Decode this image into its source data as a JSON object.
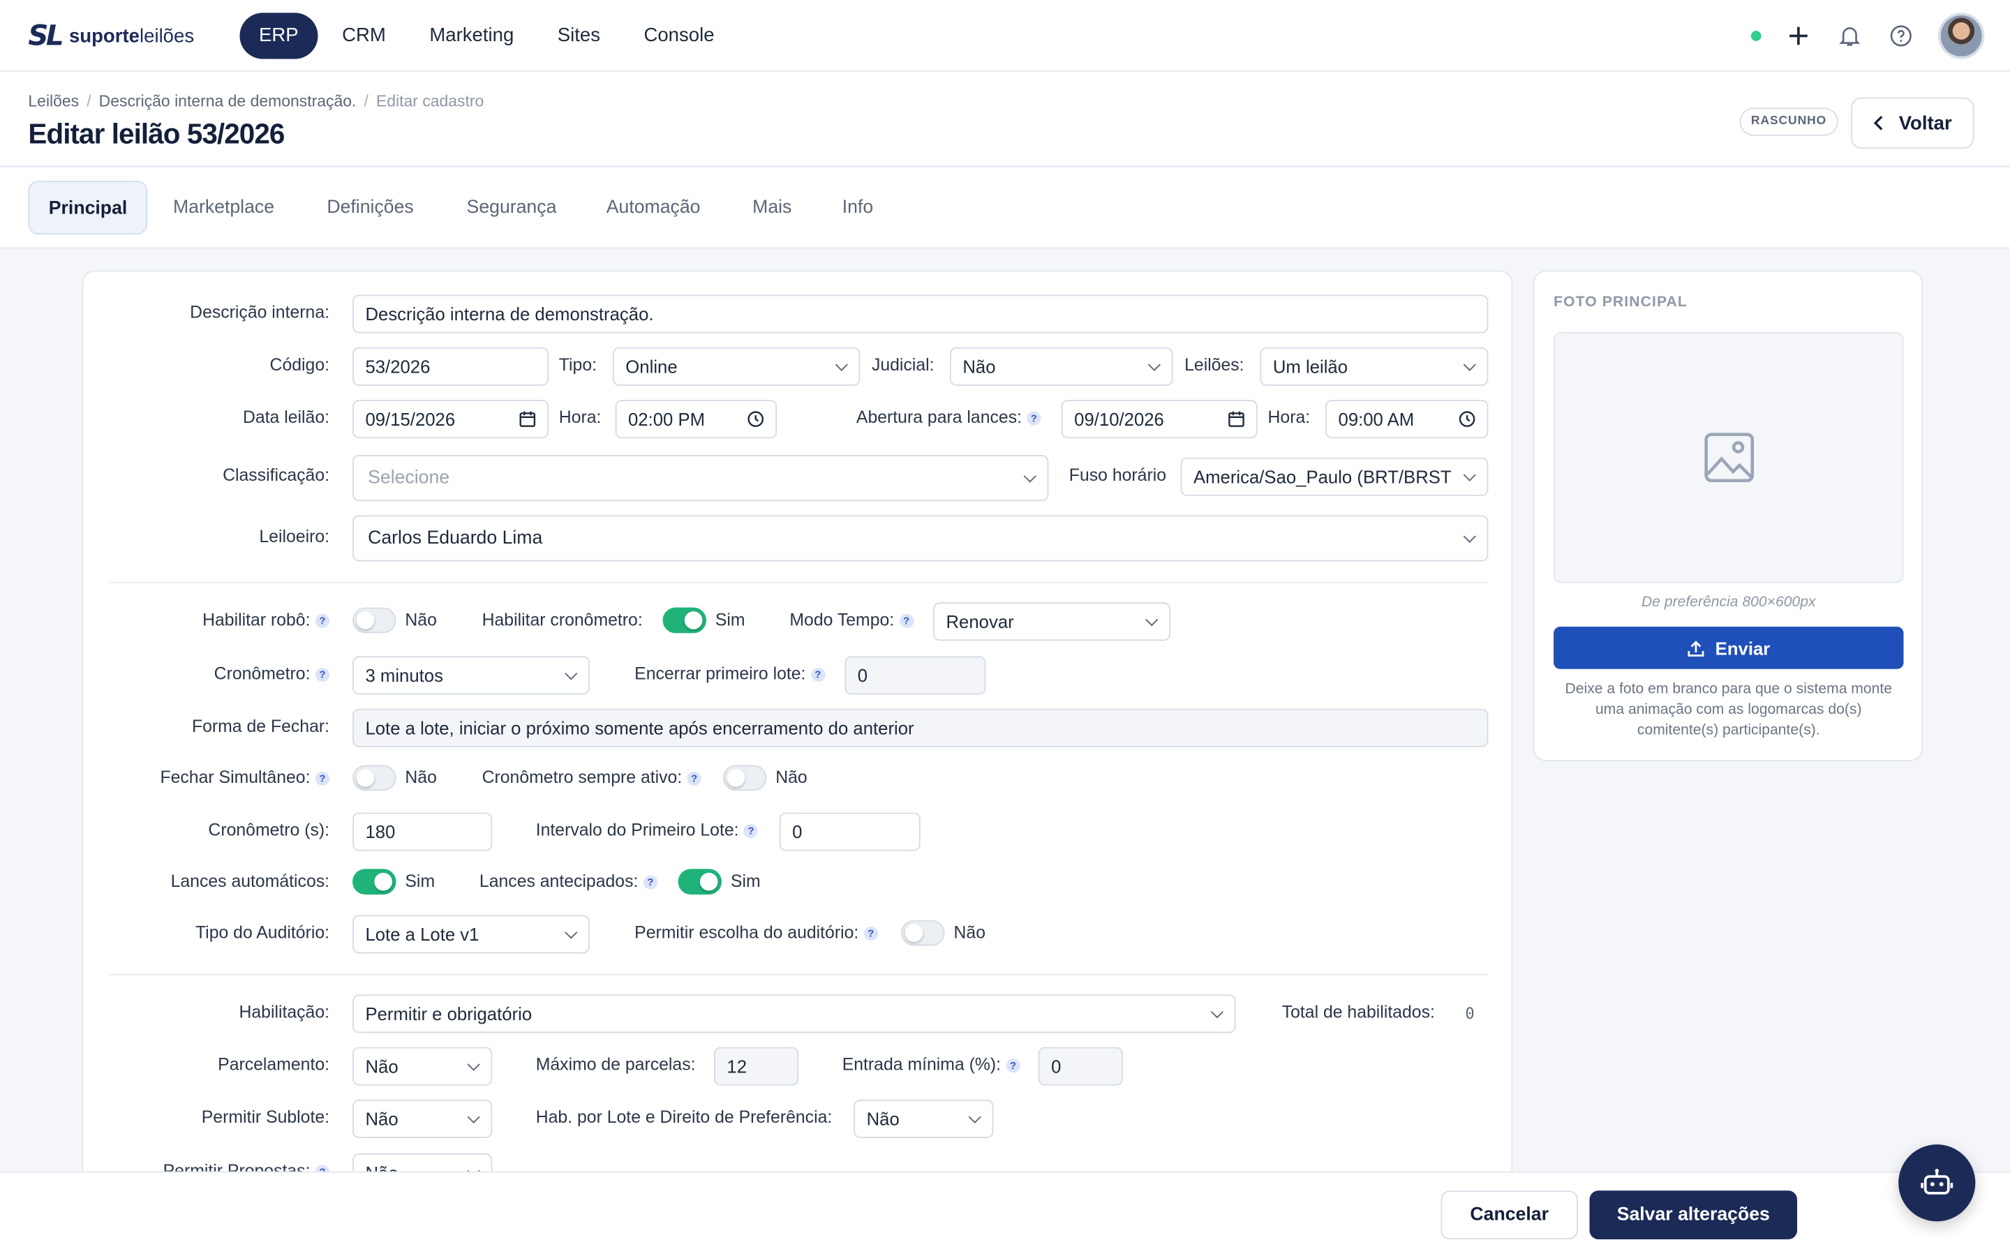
{
  "brand": {
    "mark": "SL",
    "name_bold": "suporte",
    "name_rest": "leilões"
  },
  "nav": [
    {
      "label": "ERP"
    },
    {
      "label": "CRM"
    },
    {
      "label": "Marketing"
    },
    {
      "label": "Sites"
    },
    {
      "label": "Console"
    }
  ],
  "topbar": {
    "status_color": "#2fcf8e",
    "icons": [
      "plus-icon",
      "bell-icon",
      "help-icon"
    ]
  },
  "breadcrumb": [
    "Leilões",
    "Descrição interna de demonstração.",
    "Editar cadastro"
  ],
  "page": {
    "title": "Editar leilão 53/2026",
    "status": "RASCUNHO",
    "back_label": "Voltar"
  },
  "tabs": [
    {
      "label": "Principal"
    },
    {
      "label": "Marketplace"
    },
    {
      "label": "Definições"
    },
    {
      "label": "Segurança"
    },
    {
      "label": "Automação"
    },
    {
      "label": "Mais"
    },
    {
      "label": "Info"
    }
  ],
  "form": {
    "descricao": {
      "label": "Descrição interna:",
      "value": "Descrição interna de demonstração."
    },
    "codigo": {
      "label": "Código:",
      "value": "53/2026"
    },
    "tipo": {
      "label": "Tipo:",
      "value": "Online"
    },
    "judicial": {
      "label": "Judicial:",
      "value": "Não"
    },
    "leiloes": {
      "label": "Leilões:",
      "value": "Um leilão"
    },
    "data_leilao": {
      "label": "Data leilão:",
      "value": "09/15/2026"
    },
    "hora": {
      "label": "Hora:",
      "value": "02:00 PM"
    },
    "abertura": {
      "label": "Abertura para lances:",
      "value": "09/10/2026"
    },
    "hora_abertura": {
      "label": "Hora:",
      "value": "09:00 AM"
    },
    "classificacao": {
      "label": "Classificação:",
      "placeholder": "Selecione"
    },
    "fuso": {
      "label": "Fuso horário",
      "value": "America/Sao_Paulo (BRT/BRST"
    },
    "leiloeiro": {
      "label": "Leiloeiro:",
      "value": "Carlos Eduardo Lima"
    },
    "robo": {
      "label": "Habilitar robô:",
      "value": "Não",
      "on": false
    },
    "cronometro_toggle": {
      "label": "Habilitar cronômetro:",
      "value": "Sim",
      "on": true
    },
    "modo_tempo": {
      "label": "Modo Tempo:",
      "value": "Renovar"
    },
    "cronometro": {
      "label": "Cronômetro:",
      "value": "3 minutos"
    },
    "encerrar_primeiro": {
      "label": "Encerrar primeiro lote:",
      "value": "0"
    },
    "forma_fechar": {
      "label": "Forma de Fechar:",
      "value": "Lote a lote, iniciar o próximo somente após encerramento do anterior"
    },
    "fechar_simultaneo": {
      "label": "Fechar Simultâneo:",
      "value": "Não",
      "on": false
    },
    "cronometro_ativo": {
      "label": "Cronômetro sempre ativo:",
      "value": "Não",
      "on": false
    },
    "cronometro_s": {
      "label": "Cronômetro (s):",
      "value": "180"
    },
    "intervalo_primeiro": {
      "label": "Intervalo do Primeiro Lote:",
      "value": "0"
    },
    "lances_auto": {
      "label": "Lances automáticos:",
      "value": "Sim",
      "on": true
    },
    "lances_antecipados": {
      "label": "Lances antecipados:",
      "value": "Sim",
      "on": true
    },
    "tipo_auditorio": {
      "label": "Tipo do Auditório:",
      "value": "Lote a Lote v1"
    },
    "escolha_auditorio": {
      "label": "Permitir escolha do auditório:",
      "value": "Não",
      "on": false
    },
    "habilitacao": {
      "label": "Habilitação:",
      "value": "Permitir e obrigatório"
    },
    "total_habilitados": {
      "label": "Total de habilitados:",
      "value": "0"
    },
    "parcelamento": {
      "label": "Parcelamento:",
      "value": "Não"
    },
    "max_parcelas": {
      "label": "Máximo de parcelas:",
      "value": "12"
    },
    "entrada_minima": {
      "label": "Entrada mínima (%):",
      "value": "0"
    },
    "sublote": {
      "label": "Permitir Sublote:",
      "value": "Não"
    },
    "hab_lote": {
      "label": "Hab. por Lote e Direito de Preferência:",
      "value": "Não"
    },
    "propostas": {
      "label": "Permitir Propostas:",
      "value": "Não"
    }
  },
  "photo": {
    "title": "FOTO PRINCIPAL",
    "hint": "De preferência 800×600px",
    "upload_label": "Enviar",
    "note": "Deixe a foto em branco para que o sistema monte uma animação com as logomarcas do(s) comitente(s) participante(s)."
  },
  "footer": {
    "cancel_label": "Cancelar",
    "save_label": "Salvar alterações"
  },
  "colors": {
    "brand": "#1b2a57",
    "primary": "#1f4fb8",
    "toggle_on": "#1fb37a"
  }
}
